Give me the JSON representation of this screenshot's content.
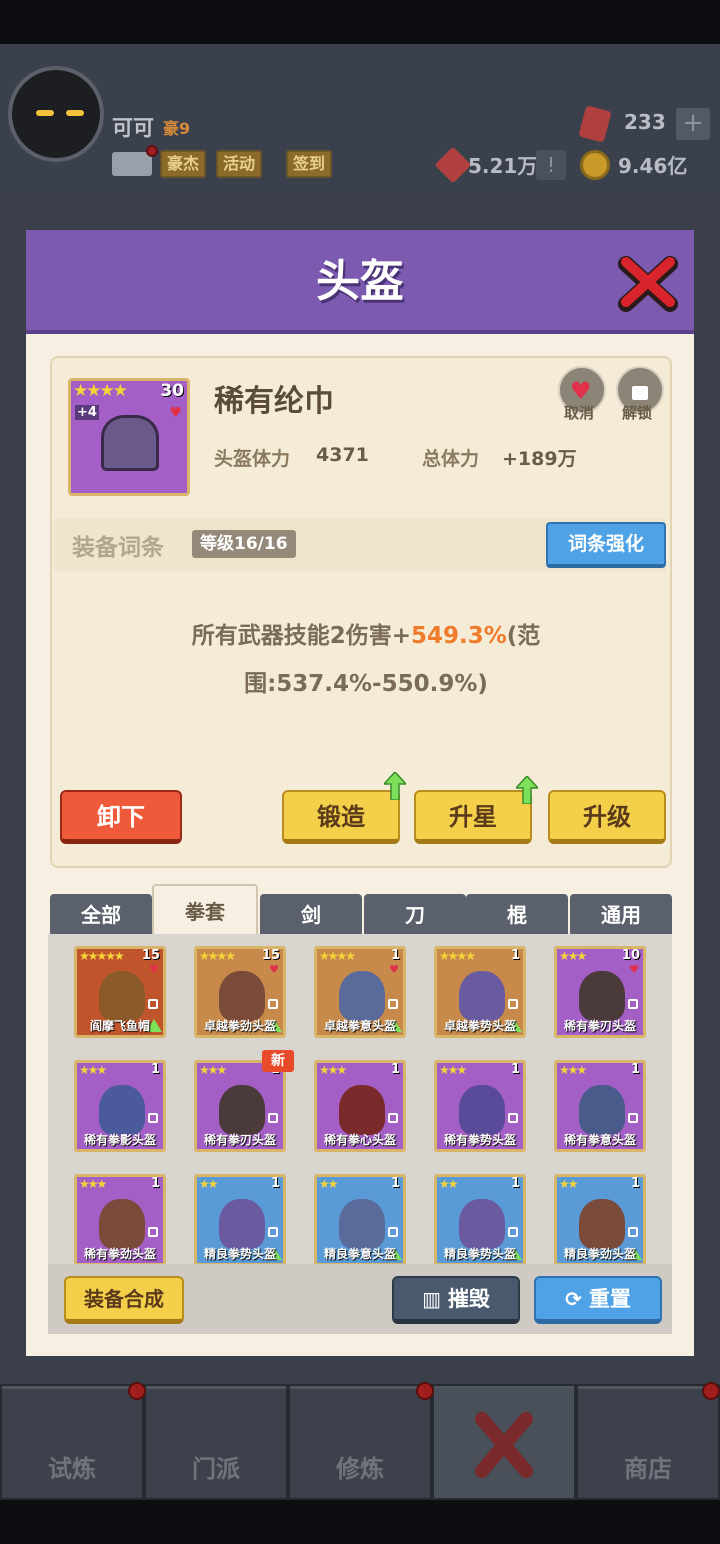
{
  "player": {
    "name": "可可",
    "level": "豪9",
    "tags": [
      "豪杰",
      "活动",
      "签到"
    ]
  },
  "resources": {
    "gems": "233",
    "power": "5.21万",
    "gold": "9.46亿"
  },
  "modal": {
    "title": "头盔"
  },
  "item": {
    "name": "稀有纶巾",
    "stars": "★★★★",
    "level": "30",
    "plus": "+4",
    "stat_label": "头盔体力",
    "stat_value": "4371",
    "total_label": "总体力",
    "total_value": "+189万",
    "cancel_label": "取消",
    "unlock_label": "解锁"
  },
  "affix": {
    "title": "装备词条",
    "level": "等级16/16",
    "enhance_label": "词条强化",
    "text_prefix": "所有武器技能2伤害+",
    "text_highlight": "549.3%",
    "text_suffix": "(范围:537.4%-550.9%)"
  },
  "actions": {
    "unequip": "卸下",
    "forge": "锻造",
    "star_up": "升星",
    "upgrade": "升级"
  },
  "tabs": [
    "全部",
    "拳套",
    "剑",
    "刀",
    "棍",
    "通用"
  ],
  "active_tab": "拳套",
  "inventory": [
    {
      "name": "阎摩飞鱼帽",
      "stars": "★★★★★",
      "level": "15",
      "bg": "#c0542a",
      "fig": "#8a5a2a",
      "heart": true,
      "arrow": true
    },
    {
      "name": "卓越拳劲头盔",
      "stars": "★★★★",
      "level": "15",
      "bg": "#c88a4a",
      "fig": "#7a4a3a",
      "heart": true,
      "arrow": true
    },
    {
      "name": "卓越拳意头盔",
      "stars": "★★★★",
      "level": "1",
      "bg": "#c88a4a",
      "fig": "#5a6a9a",
      "heart": true,
      "arrow": true
    },
    {
      "name": "卓越拳势头盔",
      "stars": "★★★★",
      "level": "1",
      "bg": "#c88a4a",
      "fig": "#6a5aa0",
      "heart": false,
      "arrow": true
    },
    {
      "name": "稀有拳刃头盔",
      "stars": "★★★",
      "level": "10",
      "bg": "#a45fc6",
      "fig": "#4a3a3a",
      "heart": true,
      "arrow": false
    },
    {
      "name": "稀有拳影头盔",
      "stars": "★★★",
      "level": "1",
      "bg": "#a45fc6",
      "fig": "#4a5a9a",
      "heart": false,
      "arrow": false
    },
    {
      "name": "稀有拳刃头盔",
      "stars": "★★★",
      "level": "1",
      "bg": "#a45fc6",
      "fig": "#4a3a3a",
      "heart": false,
      "arrow": false
    },
    {
      "name": "稀有拳心头盔",
      "stars": "★★★",
      "level": "1",
      "bg": "#a45fc6",
      "fig": "#7a2a2a",
      "heart": false,
      "arrow": false
    },
    {
      "name": "稀有拳势头盔",
      "stars": "★★★",
      "level": "1",
      "bg": "#a45fc6",
      "fig": "#5a4a9a",
      "heart": false,
      "arrow": false
    },
    {
      "name": "稀有拳意头盔",
      "stars": "★★★",
      "level": "1",
      "bg": "#a45fc6",
      "fig": "#4a5a8a",
      "heart": false,
      "arrow": false
    },
    {
      "name": "稀有拳劲头盔",
      "stars": "★★★",
      "level": "1",
      "bg": "#a45fc6",
      "fig": "#7a4a3a",
      "heart": false,
      "arrow": false
    },
    {
      "name": "精良拳势头盔",
      "stars": "★★",
      "level": "1",
      "bg": "#5a9ad6",
      "fig": "#6a5aa0",
      "heart": false,
      "arrow": true
    },
    {
      "name": "精良拳意头盔",
      "stars": "★★",
      "level": "1",
      "bg": "#5a9ad6",
      "fig": "#5a6a9a",
      "heart": false,
      "arrow": true
    },
    {
      "name": "精良拳势头盔",
      "stars": "★★",
      "level": "1",
      "bg": "#5a9ad6",
      "fig": "#6a5aa0",
      "heart": false,
      "arrow": true
    },
    {
      "name": "精良拳劲头盔",
      "stars": "★★",
      "level": "1",
      "bg": "#5a9ad6",
      "fig": "#7a4a3a",
      "heart": false,
      "arrow": true
    }
  ],
  "new_badge": "新",
  "footer": {
    "synthesize": "装备合成",
    "destroy": "摧毁",
    "reset": "重置"
  },
  "nav": [
    "试炼",
    "门派",
    "修炼",
    "商店"
  ]
}
